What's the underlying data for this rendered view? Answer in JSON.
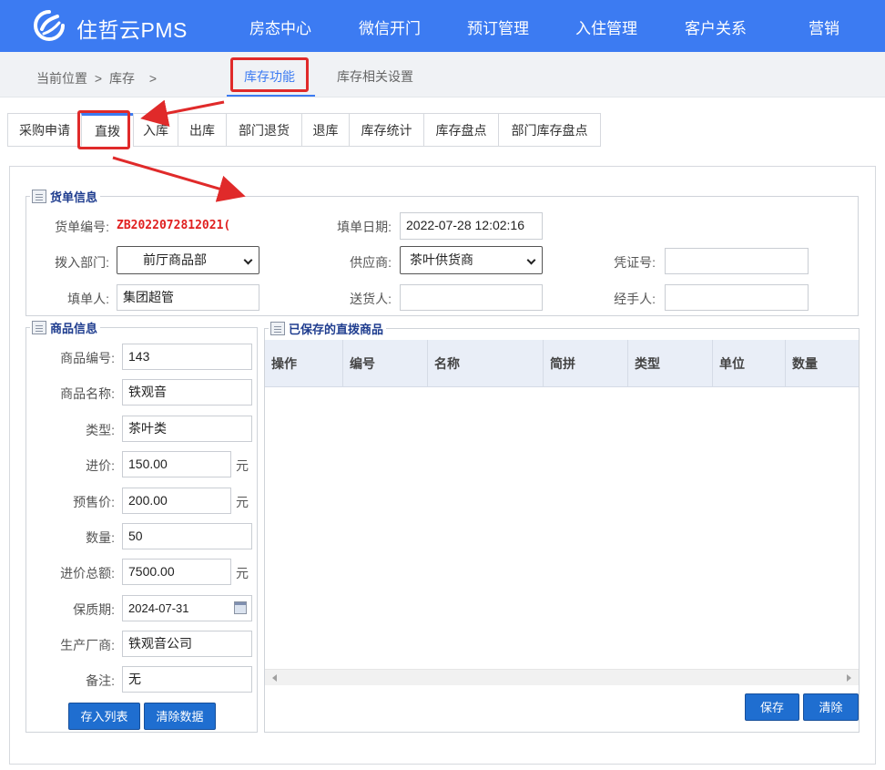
{
  "app": {
    "brand": "住哲云PMS"
  },
  "topnav": [
    "房态中心",
    "微信开门",
    "预订管理",
    "入住管理",
    "客户关系",
    "营销"
  ],
  "breadcrumb": {
    "prefix": "当前位置",
    "sep": ">",
    "item": "库存",
    "tail": ">"
  },
  "top_tabs": [
    "库存功能",
    "库存相关设置"
  ],
  "sub_tabs": [
    "采购申请",
    "直拨",
    "入库",
    "出库",
    "部门退货",
    "退库",
    "库存统计",
    "库存盘点",
    "部门库存盘点"
  ],
  "order_info": {
    "legend": "货单信息",
    "order_no_label": "货单编号:",
    "order_no": "ZB2022072812021(",
    "date_label": "填单日期:",
    "date": "2022-07-28 12:02:16",
    "dept_label": "拨入部门:",
    "dept": "前厅商品部",
    "supplier_label": "供应商:",
    "supplier": "茶叶供货商",
    "voucher_label": "凭证号:",
    "voucher": "",
    "filler_label": "填单人:",
    "filler": "集团超管",
    "deliverer_label": "送货人:",
    "deliverer": "",
    "handler_label": "经手人:",
    "handler": ""
  },
  "goods_info": {
    "legend": "商品信息",
    "code_label": "商品编号:",
    "code": "143",
    "name_label": "商品名称:",
    "name": "铁观音",
    "type_label": "类型:",
    "type": "茶叶类",
    "cost_label": "进价:",
    "cost": "150.00",
    "presale_label": "预售价:",
    "presale": "200.00",
    "qty_label": "数量:",
    "qty": "50",
    "total_label": "进价总额:",
    "total": "7500.00",
    "expiry_label": "保质期:",
    "expiry": "2024-07-31",
    "maker_label": "生产厂商:",
    "maker": "铁观音公司",
    "note_label": "备注:",
    "note": "无",
    "unit": "元",
    "save_list_button": "存入列表",
    "clear_data_button": "清除数据"
  },
  "saved_goods": {
    "legend": "已保存的直拨商品",
    "columns": [
      "操作",
      "编号",
      "名称",
      "简拼",
      "类型",
      "单位",
      "数量"
    ],
    "save_button": "保存",
    "clear_button": "清除"
  }
}
